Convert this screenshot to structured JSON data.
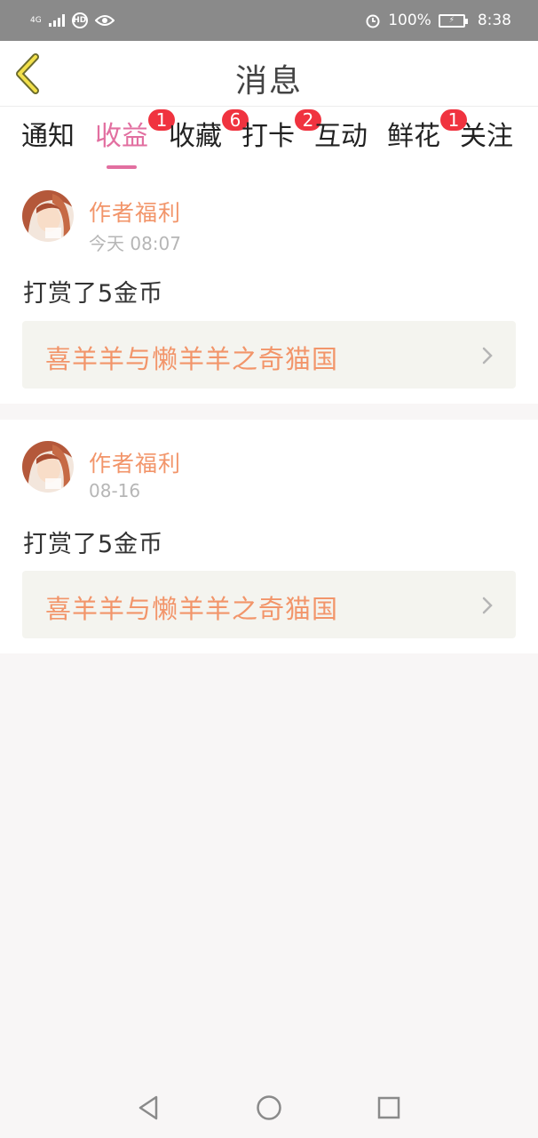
{
  "status_bar": {
    "network": "4G",
    "battery_percent": "100%",
    "time": "8:38",
    "icons": [
      "signal-icon",
      "hd-icon",
      "eye-icon",
      "alarm-icon",
      "battery-icon"
    ]
  },
  "header": {
    "title": "消息",
    "back_icon": "chevron-left-icon"
  },
  "tabs": [
    {
      "label": "通知",
      "badge": ""
    },
    {
      "label": "收益",
      "badge": "1",
      "active": true
    },
    {
      "label": "收藏",
      "badge": "6"
    },
    {
      "label": "打卡",
      "badge": "2"
    },
    {
      "label": "互动",
      "badge": ""
    },
    {
      "label": "鲜花",
      "badge": "1"
    },
    {
      "label": "关注",
      "badge": ""
    }
  ],
  "messages": [
    {
      "sender": "作者福利",
      "time": "今天 08:07",
      "text": "打赏了5金币",
      "book_title": "喜羊羊与懒羊羊之奇猫国"
    },
    {
      "sender": "作者福利",
      "time": "08-16",
      "text": "打赏了5金币",
      "book_title": "喜羊羊与懒羊羊之奇猫国"
    }
  ],
  "colors": {
    "accent": "#e26fa0",
    "orange_text": "#f2956a",
    "badge_red": "#f0333f",
    "status_bar_bg": "#8a8a8a",
    "page_bg": "#f8f6f6"
  },
  "nav_bar": {
    "icons": [
      "back-triangle-icon",
      "home-circle-icon",
      "recents-square-icon"
    ]
  }
}
